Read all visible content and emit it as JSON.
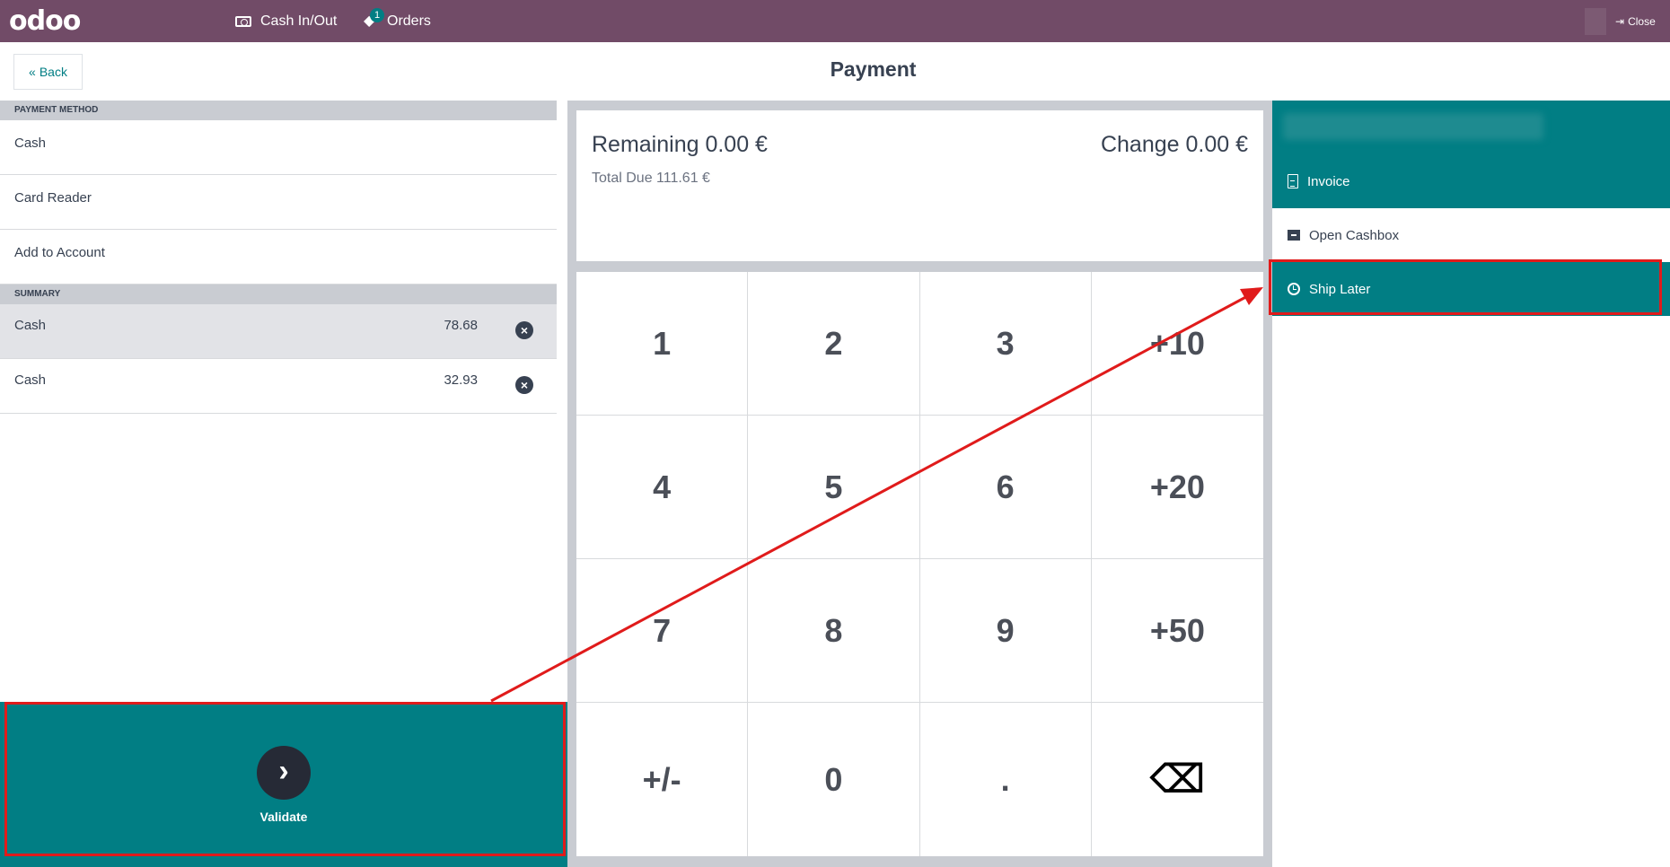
{
  "topbar": {
    "logo": "odoo",
    "cash_in_out": "Cash In/Out",
    "orders": "Orders",
    "orders_badge": "1",
    "close": "Close",
    "color": "#714B67"
  },
  "header": {
    "back": "Back",
    "title": "Payment"
  },
  "payment_methods": {
    "heading": "Payment Method",
    "items": [
      "Cash",
      "Card Reader",
      "Add to Account"
    ]
  },
  "summary": {
    "heading": "Summary",
    "lines": [
      {
        "method": "Cash",
        "amount": "78.68",
        "selected": true
      },
      {
        "method": "Cash",
        "amount": "32.93",
        "selected": false
      }
    ]
  },
  "status": {
    "remaining": "Remaining 0.00 €",
    "change": "Change 0.00 €",
    "total_due": "Total Due  111.61 €"
  },
  "numpad": {
    "keys": [
      "1",
      "2",
      "3",
      "+10",
      "4",
      "5",
      "6",
      "+20",
      "7",
      "8",
      "9",
      "+50",
      "+/-",
      "0",
      ".",
      "⌫"
    ]
  },
  "actions": {
    "invoice": "Invoice",
    "open_cashbox": "Open Cashbox",
    "ship_later": "Ship Later"
  },
  "validate": {
    "label": "Validate",
    "icon": "›"
  },
  "colors": {
    "accent": "#017e84",
    "annotation": "#e01b1b"
  }
}
